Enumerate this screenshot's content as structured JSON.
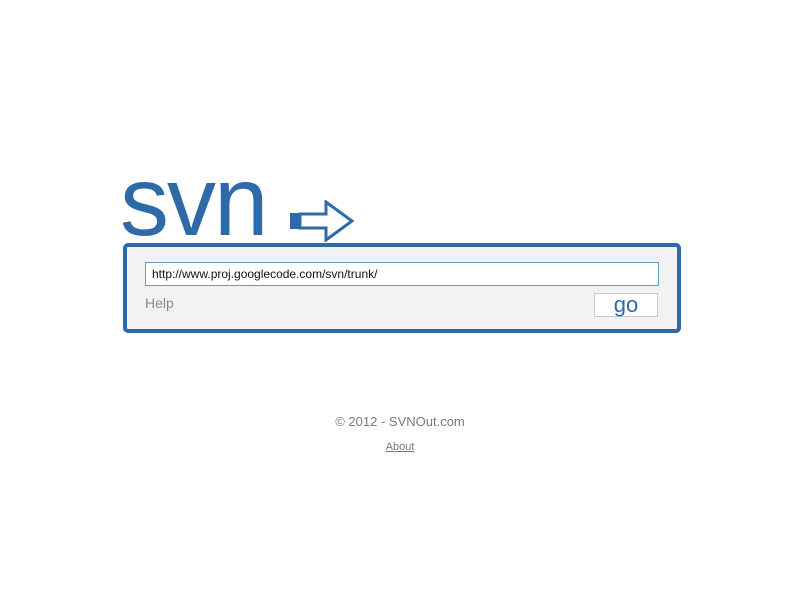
{
  "logo": {
    "text": "svn",
    "icon": "arrow-right-icon",
    "color": "#2f6aa8"
  },
  "form": {
    "url_value": "http://www.proj.googlecode.com/svn/trunk/",
    "help_label": "Help",
    "go_label": "go"
  },
  "footer": {
    "copyright": "© 2012 - SVNOut.com",
    "about_label": "About"
  },
  "colors": {
    "accent": "#2f6aa8",
    "panel_background": "#f2f2f2",
    "muted_text": "#8a8a8a"
  }
}
